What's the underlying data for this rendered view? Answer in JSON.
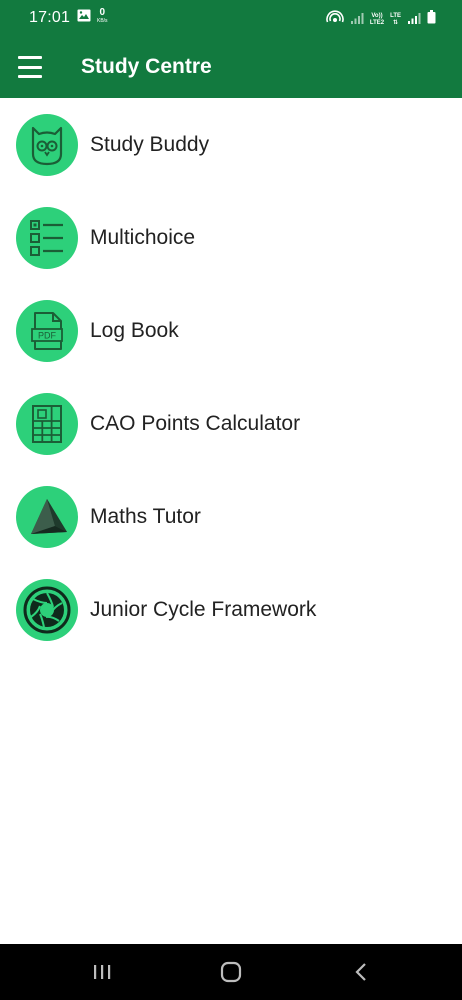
{
  "status_bar": {
    "time": "17:01",
    "speed_value": "0",
    "speed_unit": "KB/s",
    "sim1_label_top": "Vo))",
    "sim1_label_bottom": "LTE2",
    "sim2_label": "LTE",
    "icons": [
      "image-icon",
      "hotspot-icon",
      "signal-icon",
      "battery-icon"
    ]
  },
  "app_bar": {
    "title": "Study Centre",
    "menu_icon": "hamburger-menu-icon"
  },
  "menu": {
    "items": [
      {
        "label": "Study Buddy",
        "icon": "owl-icon"
      },
      {
        "label": "Multichoice",
        "icon": "checklist-icon"
      },
      {
        "label": "Log Book",
        "icon": "pdf-document-icon"
      },
      {
        "label": "CAO Points Calculator",
        "icon": "calculator-grid-icon"
      },
      {
        "label": "Maths Tutor",
        "icon": "pyramid-icon"
      },
      {
        "label": "Junior Cycle Framework",
        "icon": "aperture-icon"
      }
    ]
  },
  "nav_bar": {
    "buttons": [
      "recents-icon",
      "home-icon",
      "back-icon"
    ]
  },
  "colors": {
    "primary": "#127a3f",
    "icon_background": "#2dd07a",
    "text": "#222222",
    "nav_background": "#000000"
  }
}
